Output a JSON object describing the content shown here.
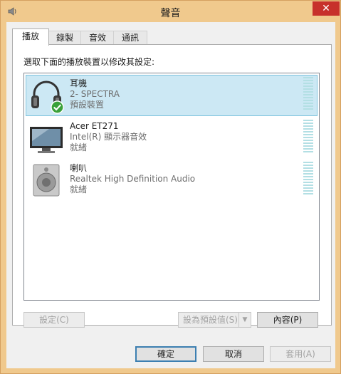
{
  "window": {
    "title": "聲音",
    "close_glyph": "✕"
  },
  "tabs": [
    {
      "label": "播放"
    },
    {
      "label": "錄製"
    },
    {
      "label": "音效"
    },
    {
      "label": "通訊"
    }
  ],
  "playback": {
    "instruction": "選取下面的播放裝置以修改其設定:",
    "devices": [
      {
        "name": "耳機",
        "detail": "2- SPECTRA",
        "status": "預設裝置",
        "icon": "headphones-icon",
        "selected": true,
        "default": true
      },
      {
        "name": "Acer ET271",
        "detail": "Intel(R) 顯示器音效",
        "status": "就緒",
        "icon": "monitor-icon",
        "selected": false,
        "default": false
      },
      {
        "name": "喇叭",
        "detail": "Realtek High Definition Audio",
        "status": "就緒",
        "icon": "speaker-icon",
        "selected": false,
        "default": false
      }
    ],
    "configure_label": "設定(C)",
    "set_default_label": "設為預設值(S)",
    "properties_label": "內容(P)"
  },
  "footer": {
    "ok_label": "確定",
    "cancel_label": "取消",
    "apply_label": "套用(A)"
  },
  "colors": {
    "title_bar": "#f0c98d",
    "close_button": "#c7302b",
    "selection_bg": "#cce8f4",
    "meter": "#b3dfe4"
  }
}
